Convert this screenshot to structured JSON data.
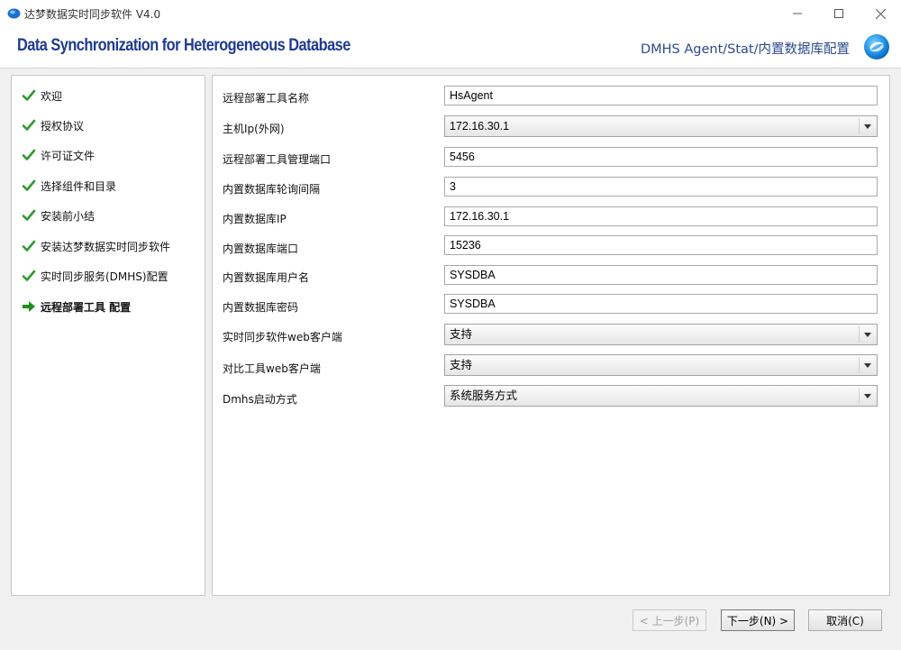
{
  "window": {
    "title": "达梦数据实时同步软件 V4.0",
    "minimize_glyph": "—",
    "maximize_glyph": "☐",
    "close_glyph": "✕"
  },
  "header": {
    "title": "Data Synchronization for Heterogeneous Database",
    "step_title": "DMHS Agent/Stat/内置数据库配置",
    "title_color": "#1f3a8f"
  },
  "steps": [
    {
      "label": "欢迎",
      "status": "done",
      "icon": "check-icon"
    },
    {
      "label": "授权协议",
      "status": "done",
      "icon": "check-icon"
    },
    {
      "label": "许可证文件",
      "status": "done",
      "icon": "check-icon"
    },
    {
      "label": "选择组件和目录",
      "status": "done",
      "icon": "check-icon"
    },
    {
      "label": "安装前小结",
      "status": "done",
      "icon": "check-icon"
    },
    {
      "label": "安装达梦数据实时同步软件",
      "status": "done",
      "icon": "check-icon"
    },
    {
      "label": "实时同步服务(DMHS)配置",
      "status": "done",
      "icon": "check-icon"
    },
    {
      "label": "远程部署工具 配置",
      "status": "current",
      "icon": "arrow-right-icon"
    }
  ],
  "form": {
    "fields": [
      {
        "label": "远程部署工具名称",
        "type": "text",
        "value": "HsAgent"
      },
      {
        "label": "主机Ip(外网)",
        "type": "select",
        "value": "172.16.30.1"
      },
      {
        "label": "远程部署工具管理端口",
        "type": "text",
        "value": "5456"
      },
      {
        "label": "内置数据库轮询间隔",
        "type": "text",
        "value": "3"
      },
      {
        "label": "内置数据库IP",
        "type": "text",
        "value": "172.16.30.1"
      },
      {
        "label": "内置数据库端口",
        "type": "text",
        "value": "15236"
      },
      {
        "label": "内置数据库用户名",
        "type": "text",
        "value": "SYSDBA"
      },
      {
        "label": "内置数据库密码",
        "type": "text",
        "value": "SYSDBA"
      },
      {
        "label": "实时同步软件web客户端",
        "type": "select",
        "value": "支持"
      },
      {
        "label": "对比工具web客户端",
        "type": "select",
        "value": "支持"
      },
      {
        "label": "Dmhs启动方式",
        "type": "select",
        "value": "系统服务方式"
      }
    ]
  },
  "buttons": {
    "prev": "< 上一步(P)",
    "next": "下一步(N) >",
    "cancel": "取消(C)"
  },
  "colors": {
    "check": "#2e9a2e",
    "arrow": "#1e8f1e",
    "accent": "#1f3a8f"
  }
}
